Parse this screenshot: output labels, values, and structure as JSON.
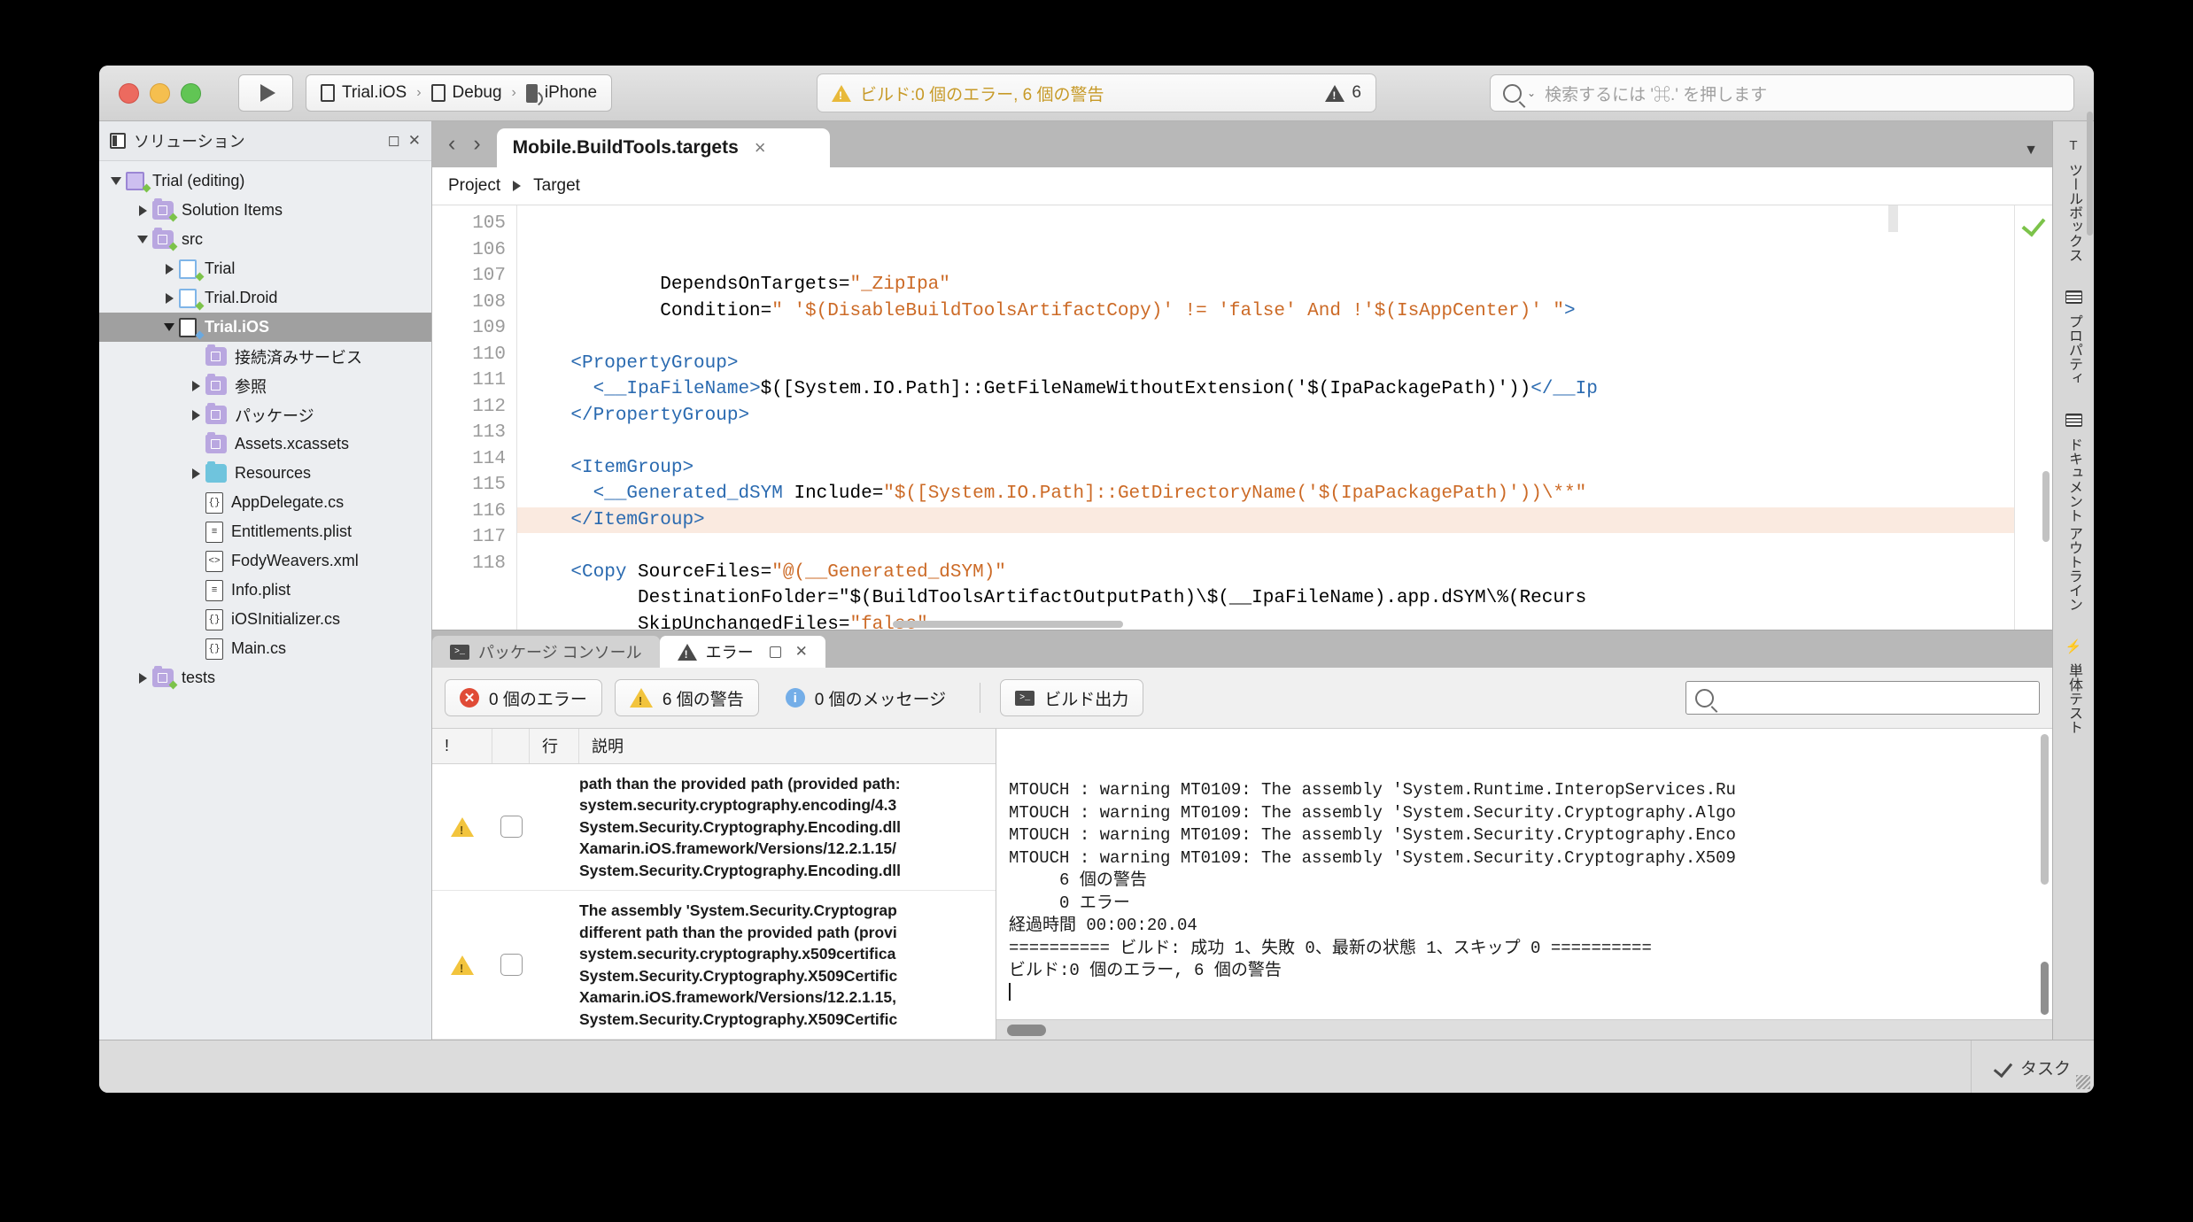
{
  "toolbar": {
    "run_label": "run",
    "project": "Trial.iOS",
    "configuration": "Debug",
    "device": "iPhone",
    "status_text": "ビルド:0 個のエラー, 6 個の警告",
    "warning_count": "6",
    "search_placeholder": "検索するには '⌘.' を押します"
  },
  "solution_pad": {
    "title": "ソリューション",
    "tree": [
      {
        "label": "Trial (editing)",
        "icon": "solution-icon",
        "twisty": "down",
        "depth": 0,
        "selected": false,
        "dot": "green"
      },
      {
        "label": "Solution Items",
        "icon": "folder-icon",
        "twisty": "right",
        "depth": 1,
        "selected": false,
        "dot": "green"
      },
      {
        "label": "src",
        "icon": "folder-icon",
        "twisty": "down",
        "depth": 1,
        "selected": false,
        "dot": "green"
      },
      {
        "label": "Trial",
        "icon": "project-icon",
        "twisty": "right",
        "depth": 2,
        "selected": false,
        "dot": "green"
      },
      {
        "label": "Trial.Droid",
        "icon": "project-icon",
        "twisty": "right",
        "depth": 2,
        "selected": false,
        "dot": "green"
      },
      {
        "label": "Trial.iOS",
        "icon": "project-icon-gray",
        "twisty": "down",
        "depth": 2,
        "selected": true,
        "dot": "blue"
      },
      {
        "label": "接続済みサービス",
        "icon": "connected-services-icon",
        "twisty": "none",
        "depth": 3,
        "selected": false,
        "dot": "none"
      },
      {
        "label": "参照",
        "icon": "references-icon",
        "twisty": "right",
        "depth": 3,
        "selected": false,
        "dot": "none"
      },
      {
        "label": "パッケージ",
        "icon": "packages-icon",
        "twisty": "right",
        "depth": 3,
        "selected": false,
        "dot": "none"
      },
      {
        "label": "Assets.xcassets",
        "icon": "assets-icon",
        "twisty": "none",
        "depth": 3,
        "selected": false,
        "dot": "none"
      },
      {
        "label": "Resources",
        "icon": "folder-blue-icon",
        "twisty": "right",
        "depth": 3,
        "selected": false,
        "dot": "none"
      },
      {
        "label": "AppDelegate.cs",
        "icon": "csharp-file-icon",
        "twisty": "none",
        "depth": 3,
        "selected": false,
        "dot": "none"
      },
      {
        "label": "Entitlements.plist",
        "icon": "plist-file-icon",
        "twisty": "none",
        "depth": 3,
        "selected": false,
        "dot": "none"
      },
      {
        "label": "FodyWeavers.xml",
        "icon": "xml-file-icon",
        "twisty": "none",
        "depth": 3,
        "selected": false,
        "dot": "none"
      },
      {
        "label": "Info.plist",
        "icon": "plist-file-icon",
        "twisty": "none",
        "depth": 3,
        "selected": false,
        "dot": "none"
      },
      {
        "label": "iOSInitializer.cs",
        "icon": "csharp-file-icon",
        "twisty": "none",
        "depth": 3,
        "selected": false,
        "dot": "none"
      },
      {
        "label": "Main.cs",
        "icon": "csharp-file-icon",
        "twisty": "none",
        "depth": 3,
        "selected": false,
        "dot": "none"
      },
      {
        "label": "tests",
        "icon": "folder-icon",
        "twisty": "right",
        "depth": 1,
        "selected": false,
        "dot": "green"
      }
    ]
  },
  "editor": {
    "tab_title": "Mobile.BuildTools.targets",
    "tab_close": "×",
    "nav_back": "‹",
    "nav_forward": "›",
    "dropdown_caret": "▼",
    "breadcrumb_project": "Project",
    "breadcrumb_target": "Target",
    "lines": [
      {
        "n": "105",
        "text": "            DependsOnTargets=\"_ZipIpa\"",
        "highlight": false
      },
      {
        "n": "106",
        "text": "            Condition=\" '$(DisableBuildToolsArtifactCopy)' != 'false' And !'$(IsAppCenter)' \">",
        "highlight": false
      },
      {
        "n": "107",
        "text": "",
        "highlight": false
      },
      {
        "n": "108",
        "text": "    <PropertyGroup>",
        "highlight": false
      },
      {
        "n": "109",
        "text": "      <__IpaFileName>$([System.IO.Path]::GetFileNameWithoutExtension('$(IpaPackagePath)'))</__Ip",
        "highlight": false
      },
      {
        "n": "110",
        "text": "    </PropertyGroup>",
        "highlight": false
      },
      {
        "n": "111",
        "text": "",
        "highlight": false
      },
      {
        "n": "112",
        "text": "    <ItemGroup>",
        "highlight": false
      },
      {
        "n": "113",
        "text": "      <__Generated_dSYM Include=\"$([System.IO.Path]::GetDirectoryName('$(IpaPackagePath)'))\\**\"",
        "highlight": false
      },
      {
        "n": "114",
        "text": "    </ItemGroup>",
        "highlight": true
      },
      {
        "n": "115",
        "text": "",
        "highlight": false
      },
      {
        "n": "116",
        "text": "    <Copy SourceFiles=\"@(__Generated_dSYM)\"",
        "highlight": false
      },
      {
        "n": "117",
        "text": "          DestinationFolder=\"$(BuildToolsArtifactOutputPath)\\$(__IpaFileName).app.dSYM\\%(Recurs",
        "highlight": false
      },
      {
        "n": "118",
        "text": "          SkipUnchangedFiles=\"false\"",
        "highlight": false
      }
    ]
  },
  "bottom_pad": {
    "tabs": [
      {
        "label": "パッケージ コンソール",
        "icon": "terminal-icon",
        "active": false
      },
      {
        "label": "エラー",
        "icon": "warning-icon",
        "active": true
      }
    ],
    "filters": [
      {
        "label": "0 個のエラー",
        "icon": "error-icon"
      },
      {
        "label": "6 個の警告",
        "icon": "warning-icon"
      },
      {
        "label": "0 個のメッセージ",
        "icon": "info-icon"
      }
    ],
    "build_output_label": "ビルド出力",
    "panel_search_value": "",
    "columns": [
      "!",
      "",
      "行",
      "説明"
    ],
    "rows": [
      {
        "severity": "warning",
        "line": "",
        "description": [
          "path than the provided path (provided path:",
          "system.security.cryptography.encoding/4.3",
          "System.Security.Cryptography.Encoding.dll",
          "Xamarin.iOS.framework/Versions/12.2.1.15/",
          "System.Security.Cryptography.Encoding.dll"
        ]
      },
      {
        "severity": "warning",
        "line": "",
        "description": [
          "The assembly 'System.Security.Cryptograp",
          "different path than the provided path (provi",
          "system.security.cryptography.x509certifica",
          "System.Security.Cryptography.X509Certific",
          "Xamarin.iOS.framework/Versions/12.2.1.15,",
          "System.Security.Cryptography.X509Certific"
        ]
      }
    ],
    "console_lines": [
      "MTOUCH : warning MT0109: The assembly 'System.Runtime.InteropServices.Ru",
      "MTOUCH : warning MT0109: The assembly 'System.Security.Cryptography.Algo",
      "MTOUCH : warning MT0109: The assembly 'System.Security.Cryptography.Enco",
      "MTOUCH : warning MT0109: The assembly 'System.Security.Cryptography.X509",
      "     6 個の警告",
      "     0 エラー",
      "",
      "経過時間 00:00:20.04",
      "",
      "========== ビルド: 成功 1、失敗 0、最新の状態 1、スキップ 0 ==========",
      "",
      "ビルド:0 個のエラー, 6 個の警告"
    ]
  },
  "right_dock": {
    "pads": [
      {
        "label": "ツールボックス",
        "icon": "hammer-icon"
      },
      {
        "label": "プロパティ",
        "icon": "properties-icon"
      },
      {
        "label": "ドキュメント アウトライン",
        "icon": "document-outline-icon"
      },
      {
        "label": "単体テスト",
        "icon": "lightning-icon"
      }
    ]
  },
  "status_bar": {
    "tasks_label": "タスク"
  }
}
